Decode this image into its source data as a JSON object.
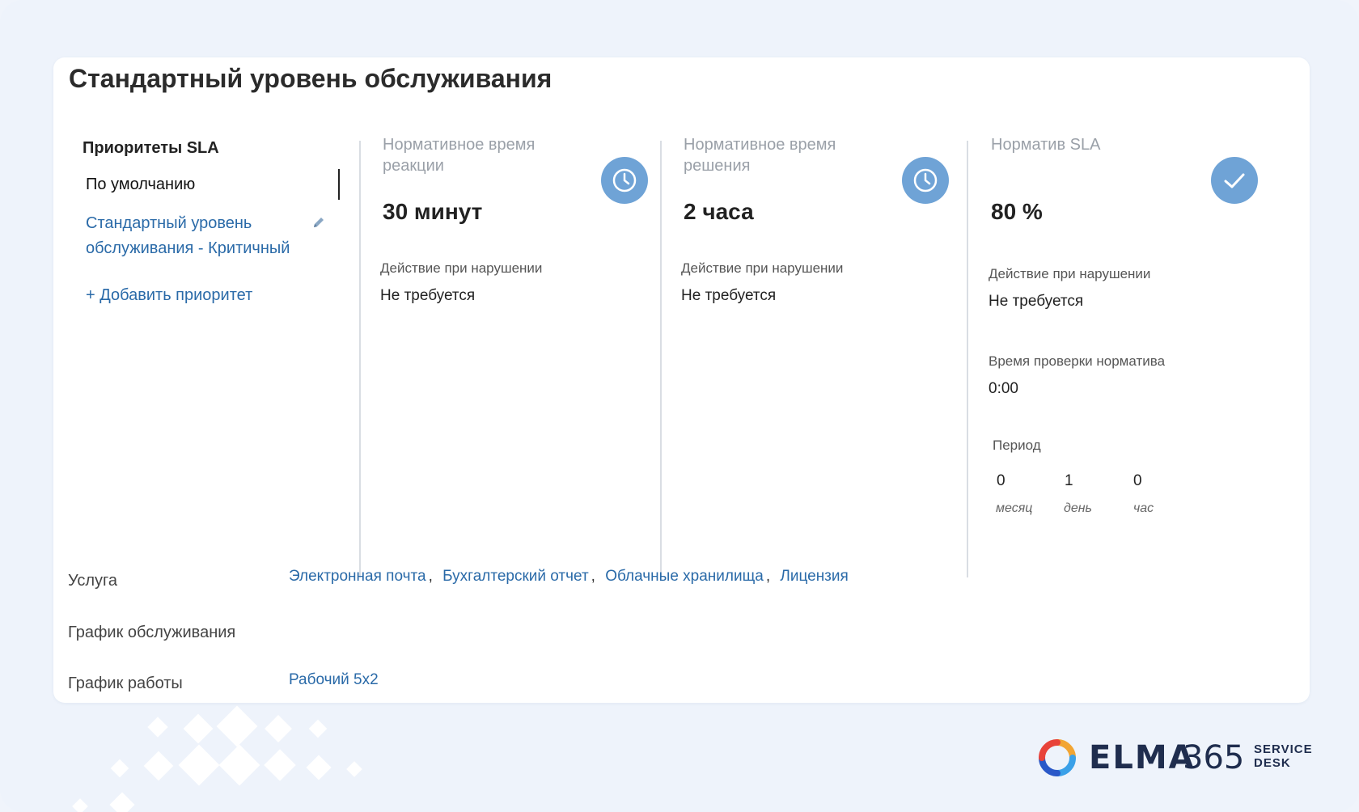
{
  "title": "Стандартный уровень обслуживания",
  "priorities": {
    "heading": "Приоритеты SLA",
    "default_item": "По умолчанию",
    "items": [
      {
        "label": "Стандартный уровень обслуживания - Критичный"
      }
    ],
    "add_label": "+ Добавить приоритет"
  },
  "metrics": {
    "reaction": {
      "label": "Нормативное время реакции",
      "value": "30 минут",
      "violation_label": "Действие при нарушении",
      "violation_value": "Не требуется",
      "icon": "clock-icon"
    },
    "resolution": {
      "label": "Нормативное время решения",
      "value": "2 часа",
      "violation_label": "Действие при нарушении",
      "violation_value": "Не требуется",
      "icon": "clock-icon"
    },
    "sla": {
      "label": "Норматив SLA",
      "value": "80 %",
      "violation_label": "Действие при нарушении",
      "violation_value": "Не требуется",
      "check_time_label": "Время проверки норматива",
      "check_time_value": "0:00",
      "period_label": "Период",
      "period": [
        {
          "value": "0",
          "unit": "месяц"
        },
        {
          "value": "1",
          "unit": "день"
        },
        {
          "value": "0",
          "unit": "час"
        }
      ],
      "icon": "check-icon"
    }
  },
  "fields": {
    "service_label": "Услуга",
    "services": [
      "Электронная почта",
      "Бухгалтерский отчет",
      "Облачные хранилища",
      "Лицензия"
    ],
    "service_schedule_label": "График обслуживания",
    "work_schedule_label": "График работы",
    "work_schedule_value": "Рабочий 5x2"
  },
  "branding": {
    "logo_word": "ELMA",
    "logo_number": "365",
    "logo_sub_1": "SERVICE",
    "logo_sub_2": "DESK"
  },
  "colors": {
    "accent": "#2a6aa8",
    "icon_bg": "#6fa3d6",
    "page_bg": "#eef3fb"
  }
}
